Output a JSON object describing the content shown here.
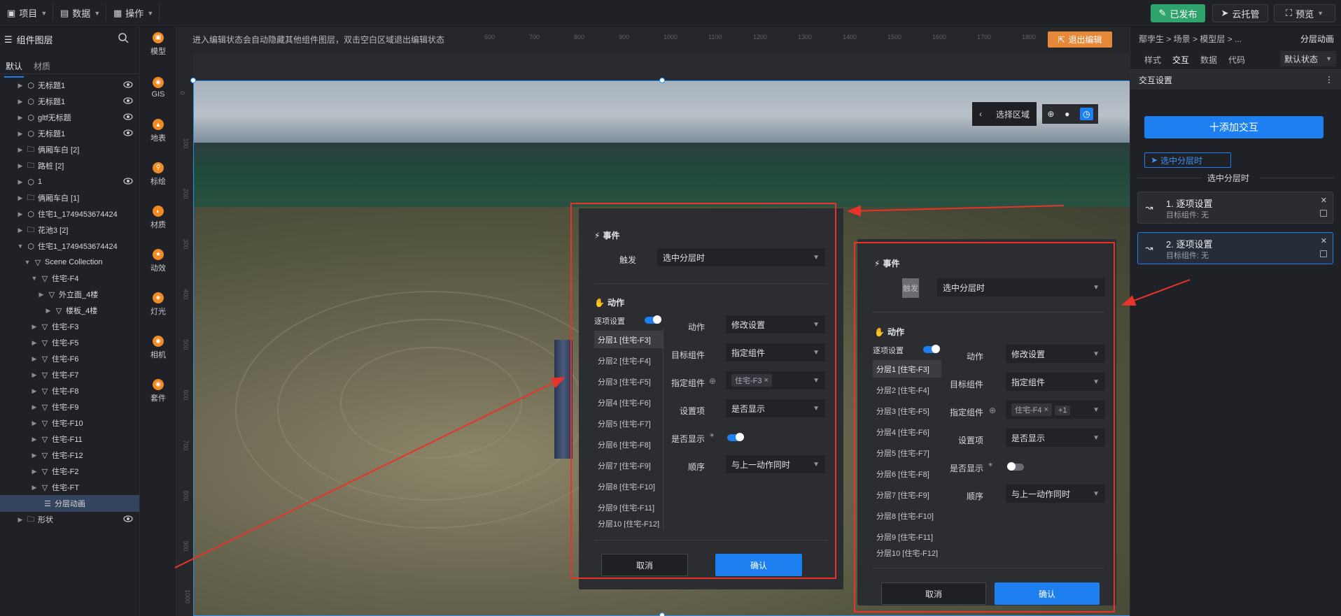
{
  "topbar": {
    "menus": [
      {
        "label": "项目",
        "icon": "file-icon"
      },
      {
        "label": "数据",
        "icon": "database-icon"
      },
      {
        "label": "操作",
        "icon": "grid-icon"
      }
    ],
    "publish": "已发布",
    "cloud": "云托管",
    "preview": "预览"
  },
  "left_panel": {
    "title": "组件图层",
    "tabs": [
      "默认",
      "材质"
    ],
    "tree": [
      {
        "label": "无标题1",
        "type": "cube",
        "eye": true
      },
      {
        "label": "无标题1",
        "type": "cube",
        "eye": true
      },
      {
        "label": "gltf无标题",
        "type": "cube",
        "eye": true
      },
      {
        "label": "无标题1",
        "type": "cube",
        "eye": true
      },
      {
        "label": "俩厢车白 [2]",
        "type": "folder",
        "eye": false
      },
      {
        "label": "路桩 [2]",
        "type": "folder",
        "eye": false
      },
      {
        "label": "1",
        "type": "cube",
        "eye": true
      },
      {
        "label": "俩厢车白 [1]",
        "type": "folder",
        "eye": false
      },
      {
        "label": "住宅1_1749453674424",
        "type": "cube",
        "eye": false
      },
      {
        "label": "花池3 [2]",
        "type": "folder",
        "eye": false
      },
      {
        "label": "住宅1_1749453674424",
        "type": "cube",
        "eye": false
      },
      {
        "label": "Scene Collection",
        "type": "node",
        "eye": false
      },
      {
        "label": "住宅-F4",
        "type": "node",
        "eye": false
      },
      {
        "label": "外立面_4楼",
        "type": "node",
        "eye": false
      },
      {
        "label": "楼板_4楼",
        "type": "node",
        "eye": false
      },
      {
        "label": "住宅-F3",
        "type": "node",
        "eye": false
      },
      {
        "label": "住宅-F5",
        "type": "node",
        "eye": false
      },
      {
        "label": "住宅-F6",
        "type": "node",
        "eye": false
      },
      {
        "label": "住宅-F7",
        "type": "node",
        "eye": false
      },
      {
        "label": "住宅-F8",
        "type": "node",
        "eye": false
      },
      {
        "label": "住宅-F9",
        "type": "node",
        "eye": false
      },
      {
        "label": "住宅-F10",
        "type": "node",
        "eye": false
      },
      {
        "label": "住宅-F11",
        "type": "node",
        "eye": false
      },
      {
        "label": "住宅-F12",
        "type": "node",
        "eye": false
      },
      {
        "label": "住宅-F2",
        "type": "node",
        "eye": false
      },
      {
        "label": "住宅-FT",
        "type": "node",
        "eye": false
      },
      {
        "label": "分层动画",
        "type": "layers",
        "eye": false
      },
      {
        "label": "形状",
        "type": "folder",
        "eye": true
      }
    ]
  },
  "tools": [
    "模型",
    "GIS",
    "地表",
    "标绘",
    "材质",
    "动效",
    "灯光",
    "相机",
    "套件"
  ],
  "canvas": {
    "hint": "进入编辑状态会自动隐藏其他组件图层，双击空白区域退出编辑状态",
    "exit_label": "退出编辑",
    "ruler_top": [
      "600",
      "700",
      "800",
      "900",
      "1000",
      "1100",
      "1200",
      "1300",
      "1400",
      "1500",
      "1600",
      "1700",
      "1800"
    ],
    "ruler_left": [
      "0",
      "100",
      "200",
      "300",
      "400",
      "500",
      "600",
      "700",
      "800",
      "900",
      "1000"
    ],
    "region_label": "选择区域"
  },
  "right_panel": {
    "breadcrumb": "鄢孛生 > 场景 > 模型层 > ...",
    "component": "分层动画",
    "tabs": [
      "样式",
      "交互",
      "数据",
      "代码"
    ],
    "state": "默认状态",
    "section": "交互设置",
    "add_btn": "十添加交互",
    "chip": "选中分层时",
    "divider_label": "选中分层时",
    "actions": [
      {
        "title": "1. 逐项设置",
        "target": "目标组件: 无"
      },
      {
        "title": "2. 逐项设置",
        "target": "目标组件: 无"
      }
    ]
  },
  "dialog1": {
    "event_title": "事件",
    "trigger_label": "触发",
    "trigger_value": "选中分层时",
    "action_title": "动作",
    "list_title": "逐项设置",
    "list": [
      "分层1 [住宅-F3]",
      "分层2 [住宅-F4]",
      "分层3 [住宅-F5]",
      "分层4 [住宅-F6]",
      "分层5 [住宅-F7]",
      "分层6 [住宅-F8]",
      "分层7 [住宅-F9]",
      "分层8 [住宅-F10]",
      "分层9 [住宅-F11]",
      "分层10 [住宅-F12]"
    ],
    "fields": {
      "action_label": "动作",
      "action_value": "修改设置",
      "target_label": "目标组件",
      "target_value": "指定组件",
      "specify_label": "指定组件",
      "specify_tag": "住宅-F3",
      "setting_label": "设置项",
      "setting_value": "是否显示",
      "show_label": "是否显示",
      "order_label": "顺序",
      "order_value": "与上一动作同时"
    },
    "cancel": "取消",
    "ok": "确认"
  },
  "dialog2": {
    "event_title": "事件",
    "trigger_label": "触发",
    "trigger_value": "选中分层时",
    "action_title": "动作",
    "list_title": "逐项设置",
    "list": [
      "分层1 [住宅-F3]",
      "分层2 [住宅-F4]",
      "分层3 [住宅-F5]",
      "分层4 [住宅-F6]",
      "分层5 [住宅-F7]",
      "分层6 [住宅-F8]",
      "分层7 [住宅-F9]",
      "分层8 [住宅-F10]",
      "分层9 [住宅-F11]",
      "分层10 [住宅-F12]"
    ],
    "fields": {
      "action_label": "动作",
      "action_value": "修改设置",
      "target_label": "目标组件",
      "target_value": "指定组件",
      "specify_label": "指定组件",
      "specify_tag": "住宅-F4",
      "specify_more": "+1",
      "setting_label": "设置项",
      "setting_value": "是否显示",
      "show_label": "是否显示",
      "order_label": "顺序",
      "order_value": "与上一动作同时"
    },
    "cancel": "取消",
    "ok": "确认"
  },
  "colors": {
    "accent": "#1d7ff0",
    "publish": "#2ea36b",
    "annotation": "#e8332b",
    "exit": "#e8893a"
  }
}
